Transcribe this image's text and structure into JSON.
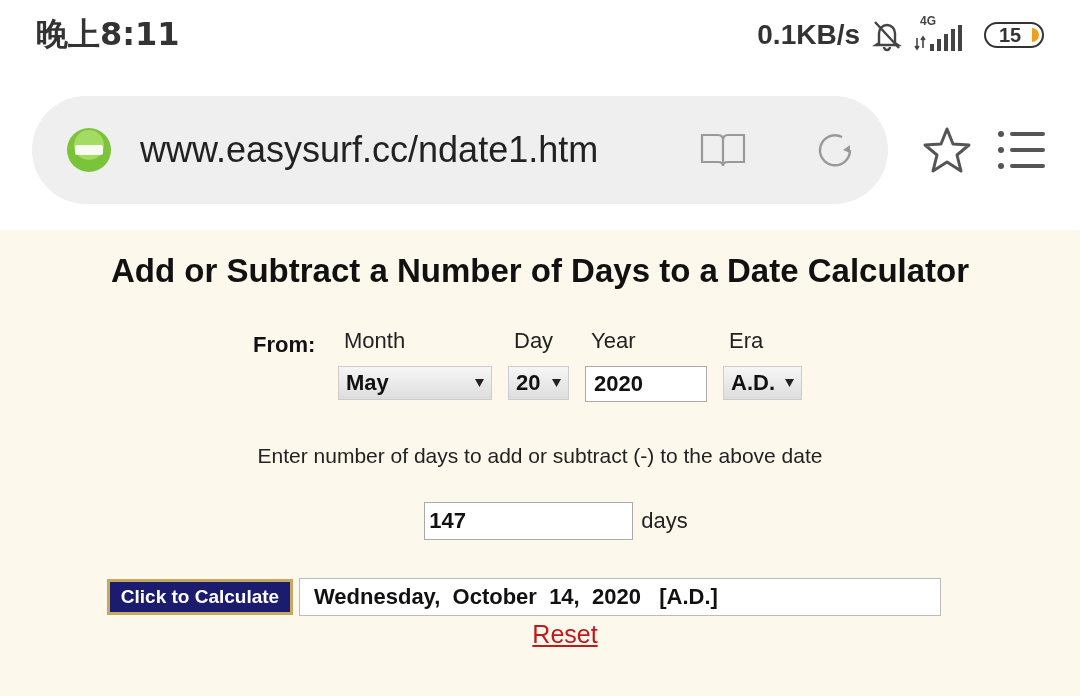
{
  "status_bar": {
    "time": "晚上8:11",
    "speed": "0.1KB/s",
    "network": "4G",
    "battery": "15"
  },
  "address_bar": {
    "url": "www.easysurf.cc/ndate1.htm"
  },
  "page": {
    "title": "Add or Subtract a Number of Days to a Date Calculator",
    "from_label": "From:",
    "fields": [
      {
        "kind": "select",
        "label": "Month",
        "value": "May"
      },
      {
        "kind": "select",
        "label": "Day",
        "value": "20"
      },
      {
        "kind": "input",
        "label": "Year",
        "value": "2020"
      },
      {
        "kind": "select",
        "label": "Era",
        "value": "A.D."
      }
    ],
    "instruction": "Enter number of days to add or subtract (-) to the above date",
    "days": {
      "value": "147",
      "unit": "days"
    },
    "calculate_button": "Click to Calculate",
    "result": "Wednesday,  October  14,  2020   [A.D.]",
    "reset_link": "Reset"
  }
}
